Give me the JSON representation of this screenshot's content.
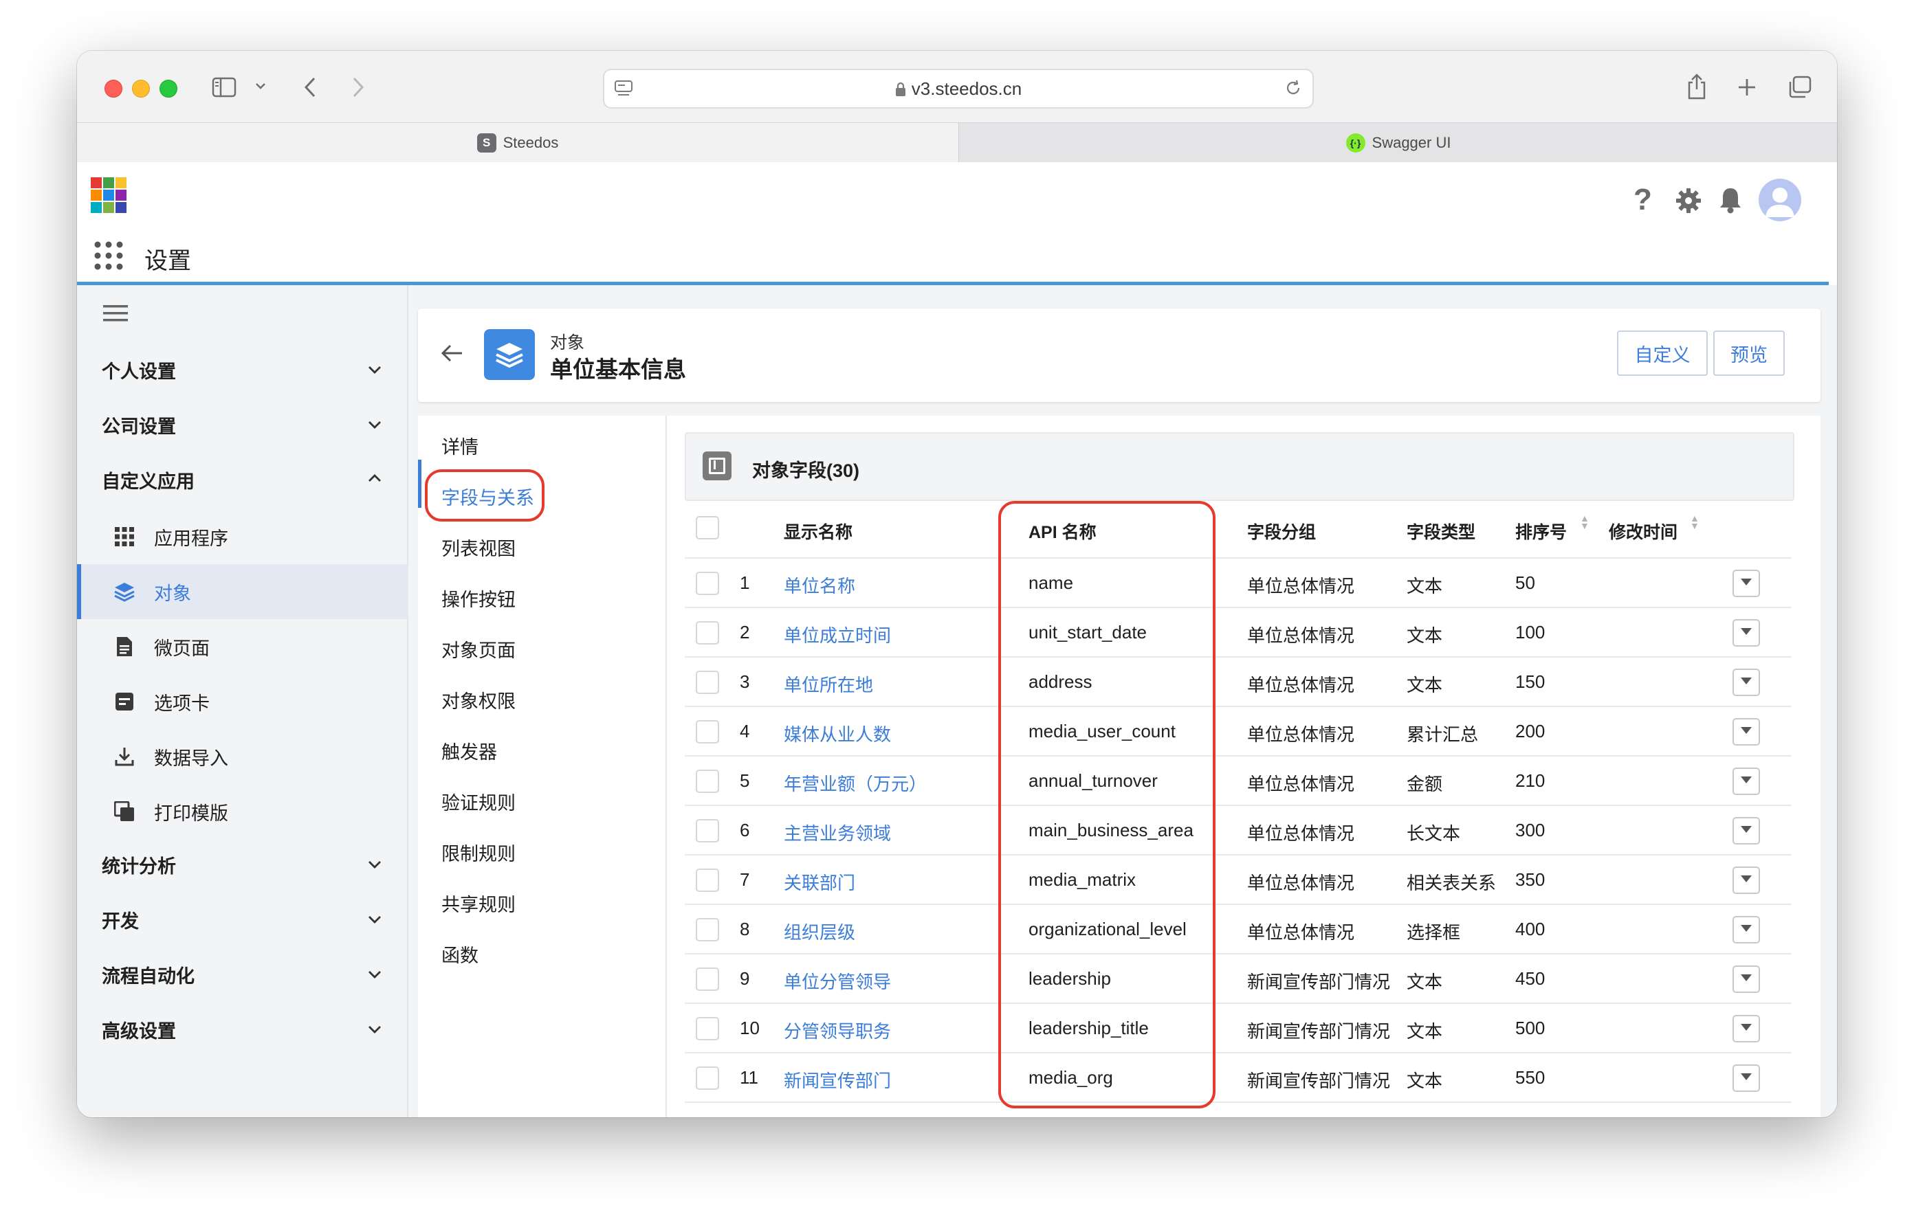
{
  "browser": {
    "address": "v3.steedos.cn",
    "tabs": [
      {
        "label": "Steedos",
        "active": true,
        "favicon": "S"
      },
      {
        "label": "Swagger UI",
        "active": false
      }
    ]
  },
  "app": {
    "title": "设置",
    "header_icons": [
      "help-icon",
      "gear-icon",
      "bell-icon",
      "avatar"
    ]
  },
  "sidebar": {
    "groups": {
      "personal": "个人设置",
      "company": "公司设置",
      "custom_apps": "自定义应用",
      "analytics": "统计分析",
      "develop": "开发",
      "workflow": "流程自动化",
      "advanced": "高级设置"
    },
    "items": [
      {
        "label": "应用程序",
        "icon": "grid-icon"
      },
      {
        "label": "对象",
        "icon": "layers-icon",
        "active": true
      },
      {
        "label": "微页面",
        "icon": "page-icon"
      },
      {
        "label": "选项卡",
        "icon": "tab-icon"
      },
      {
        "label": "数据导入",
        "icon": "download-icon"
      },
      {
        "label": "打印模版",
        "icon": "print-template-icon"
      }
    ]
  },
  "object": {
    "kind": "对象",
    "name": "单位基本信息",
    "buttons": {
      "customize": "自定义",
      "preview": "预览"
    }
  },
  "left_nav": [
    {
      "label": "详情"
    },
    {
      "label": "字段与关系",
      "active": true
    },
    {
      "label": "列表视图"
    },
    {
      "label": "操作按钮"
    },
    {
      "label": "对象页面"
    },
    {
      "label": "对象权限"
    },
    {
      "label": "触发器"
    },
    {
      "label": "验证规则"
    },
    {
      "label": "限制规则"
    },
    {
      "label": "共享规则"
    },
    {
      "label": "函数"
    }
  ],
  "fields_panel": {
    "title": "对象字段(30)",
    "columns": {
      "display_name": "显示名称",
      "api_name": "API 名称",
      "group": "字段分组",
      "type": "字段类型",
      "sort": "排序号",
      "modified": "修改时间"
    },
    "rows": [
      {
        "n": "1",
        "name": "单位名称",
        "api": "name",
        "group": "单位总体情况",
        "type": "文本",
        "sort": "50"
      },
      {
        "n": "2",
        "name": "单位成立时间",
        "api": "unit_start_date",
        "group": "单位总体情况",
        "type": "文本",
        "sort": "100"
      },
      {
        "n": "3",
        "name": "单位所在地",
        "api": "address",
        "group": "单位总体情况",
        "type": "文本",
        "sort": "150"
      },
      {
        "n": "4",
        "name": "媒体从业人数",
        "api": "media_user_count",
        "group": "单位总体情况",
        "type": "累计汇总",
        "sort": "200"
      },
      {
        "n": "5",
        "name": "年营业额（万元）",
        "api": "annual_turnover",
        "group": "单位总体情况",
        "type": "金额",
        "sort": "210"
      },
      {
        "n": "6",
        "name": "主营业务领域",
        "api": "main_business_area",
        "group": "单位总体情况",
        "type": "长文本",
        "sort": "300"
      },
      {
        "n": "7",
        "name": "关联部门",
        "api": "media_matrix",
        "group": "单位总体情况",
        "type": "相关表关系",
        "sort": "350"
      },
      {
        "n": "8",
        "name": "组织层级",
        "api": "organizational_level",
        "group": "单位总体情况",
        "type": "选择框",
        "sort": "400"
      },
      {
        "n": "9",
        "name": "单位分管领导",
        "api": "leadership",
        "group": "新闻宣传部门情况",
        "type": "文本",
        "sort": "450"
      },
      {
        "n": "10",
        "name": "分管领导职务",
        "api": "leadership_title",
        "group": "新闻宣传部门情况",
        "type": "文本",
        "sort": "500"
      },
      {
        "n": "11",
        "name": "新闻宣传部门",
        "api": "media_org",
        "group": "新闻宣传部门情况",
        "type": "文本",
        "sort": "550"
      }
    ]
  },
  "colors": {
    "accent": "#3b7dd8",
    "highlight": "#e53a2c"
  }
}
